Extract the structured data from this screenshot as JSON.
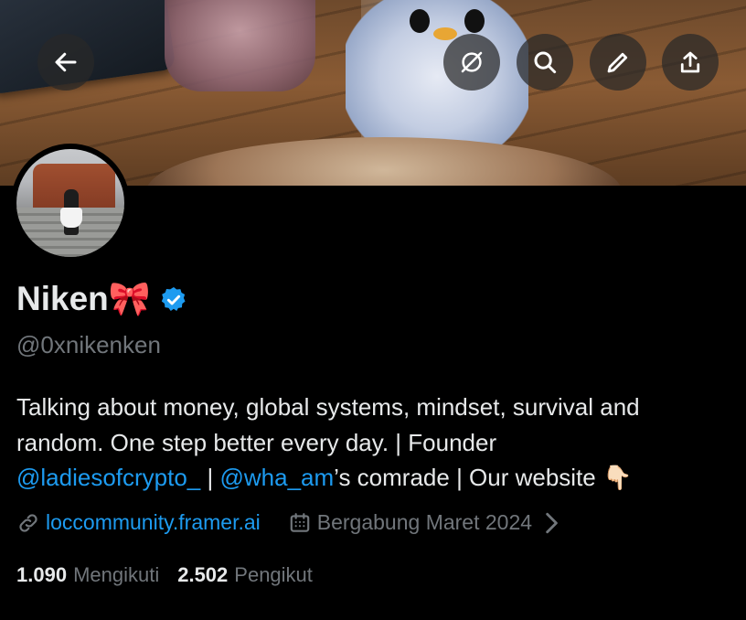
{
  "header": {
    "back_icon": "arrow-left-icon",
    "actions": [
      "no-grok-icon",
      "search-icon",
      "edit-icon",
      "share-icon"
    ]
  },
  "profile": {
    "name": "Niken🎀",
    "verified": true,
    "handle": "@0xnikenken",
    "bio": {
      "line1": "Talking about money, global systems, mindset, survival and",
      "line2": "random. One step better every day. | Founder",
      "mention1": "@ladiesofcrypto_",
      "sep1": " | ",
      "mention2": "@wha_am",
      "after_mention2": "’s comrade | Our website 👇🏻"
    },
    "website": "loccommunity.framer.ai",
    "joined": "Bergabung Maret 2024"
  },
  "stats": {
    "following_count": "1.090",
    "following_label": "Mengikuti",
    "followers_count": "2.502",
    "followers_label": "Pengikut"
  },
  "colors": {
    "accent": "#1d9bf0",
    "muted": "#71767b",
    "text": "#e7e9ea",
    "background": "#000000"
  }
}
